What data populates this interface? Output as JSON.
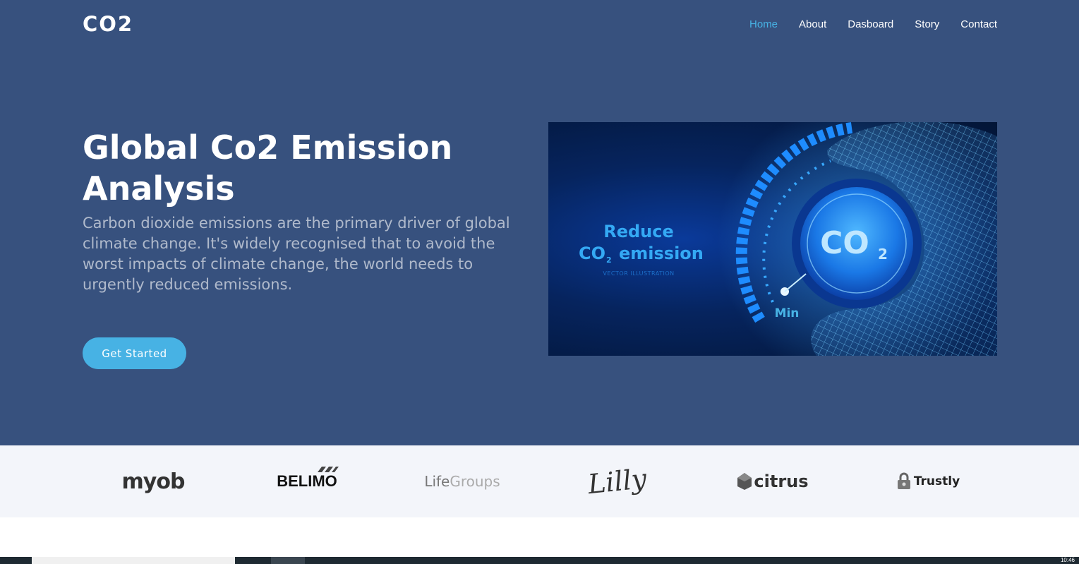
{
  "header": {
    "logo": "CO2",
    "nav": [
      {
        "label": "Home",
        "active": true
      },
      {
        "label": "About",
        "active": false
      },
      {
        "label": "Dasboard",
        "active": false
      },
      {
        "label": "Story",
        "active": false
      },
      {
        "label": "Contact",
        "active": false
      }
    ]
  },
  "hero": {
    "title_line1": "Global Co2 Emission",
    "title_line2": "Analysis",
    "description": "Carbon dioxide emissions are the primary driver of global climate change. It's widely recognised that to avoid the worst impacts of climate change, the world needs to urgently reduced emissions.",
    "cta_label": "Get Started",
    "image": {
      "text_reduce": "Reduce",
      "text_co2": "CO",
      "text_sub2": "2",
      "text_emission": "emission",
      "text_vector": "VECTOR ILLUSTRATION",
      "dial_co": "CO",
      "dial_sub": "2",
      "dial_min": "Min"
    }
  },
  "clients": [
    {
      "name": "myob"
    },
    {
      "name": "BELIMO"
    },
    {
      "name_a": "Life",
      "name_b": "Groups"
    },
    {
      "name": "Lilly"
    },
    {
      "name": "citrus"
    },
    {
      "name": "Trustly"
    }
  ],
  "taskbar": {
    "clock": "10:46"
  },
  "colors": {
    "hero_bg": "#37517e",
    "accent": "#47b2e4",
    "clients_bg": "#f3f5fa"
  }
}
